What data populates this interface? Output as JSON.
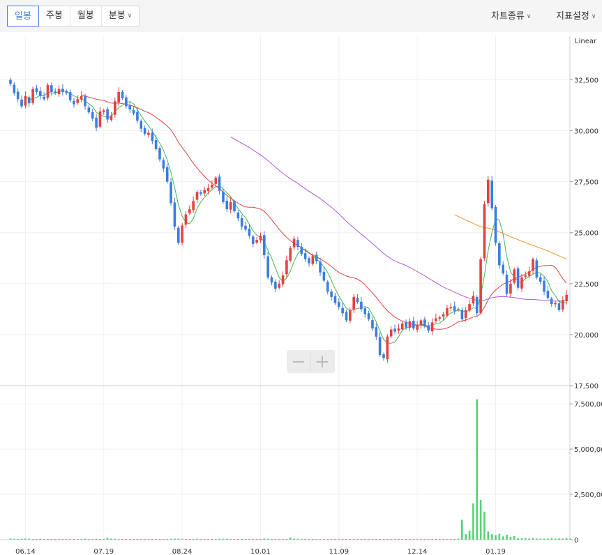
{
  "toolbar": {
    "tabs": [
      {
        "label": "일봉"
      },
      {
        "label": "주봉"
      },
      {
        "label": "월봉"
      },
      {
        "label": "분봉"
      }
    ],
    "chart_type_menu": "차트종류",
    "indicator_menu": "지표설정"
  },
  "zoom": {
    "minus": "−",
    "plus": "+"
  },
  "chart_data": {
    "type": "candlestick",
    "scale_label": "Linear",
    "price_axis": {
      "range": [
        17500,
        34500
      ],
      "ticks": [
        {
          "v": 32500,
          "label": "32,500"
        },
        {
          "v": 30000,
          "label": "30,000"
        },
        {
          "v": 27500,
          "label": "27,500"
        },
        {
          "v": 25000,
          "label": "25,000"
        },
        {
          "v": 22500,
          "label": "22,500"
        },
        {
          "v": 20000,
          "label": "20,000"
        },
        {
          "v": 17500,
          "label": "17,500"
        }
      ]
    },
    "volume_axis": {
      "range": [
        0,
        8200000
      ],
      "ticks": [
        {
          "v": 7500000,
          "label": "7,500,00"
        },
        {
          "v": 5000000,
          "label": "5,000,00"
        },
        {
          "v": 2500000,
          "label": "2,500,00"
        },
        {
          "v": 0,
          "label": "0"
        }
      ]
    },
    "x_labels": [
      {
        "i": 4,
        "label": "06.14"
      },
      {
        "i": 25,
        "label": "07.19"
      },
      {
        "i": 46,
        "label": "08.24"
      },
      {
        "i": 67,
        "label": "10.01"
      },
      {
        "i": 88,
        "label": "11.09"
      },
      {
        "i": 109,
        "label": "12.14"
      },
      {
        "i": 130,
        "label": "01.19"
      }
    ],
    "colors": {
      "up": "#e8403f",
      "down": "#3b7de0",
      "ma5": "#3dbb48",
      "ma20": "#e04040",
      "ma60": "#b15ae0",
      "ma120": "#f0942c",
      "volume": "#58cf77"
    },
    "closes": [
      32300,
      31850,
      31550,
      31200,
      31700,
      31350,
      32050,
      31900,
      31700,
      31550,
      32250,
      31900,
      31850,
      32050,
      31900,
      31850,
      31500,
      31300,
      31550,
      31700,
      31200,
      30900,
      30600,
      30150,
      30950,
      31000,
      30550,
      30750,
      31450,
      31900,
      31600,
      31200,
      31050,
      30850,
      30500,
      30100,
      29850,
      29900,
      29500,
      29100,
      28600,
      28150,
      27500,
      26450,
      25300,
      24500,
      25350,
      25900,
      26150,
      26550,
      27000,
      26900,
      27100,
      27200,
      27350,
      27700,
      27050,
      26500,
      26150,
      26500,
      26050,
      25700,
      25300,
      25150,
      24850,
      24450,
      24650,
      24850,
      23900,
      22800,
      22550,
      22250,
      22500,
      22900,
      23650,
      24250,
      24700,
      24300,
      23950,
      23700,
      23500,
      23850,
      23600,
      23050,
      22650,
      22100,
      21850,
      21550,
      21350,
      21050,
      20700,
      21200,
      21850,
      21600,
      21250,
      21000,
      20750,
      20300,
      19900,
      19000,
      18850,
      19900,
      20250,
      20150,
      20300,
      20550,
      20350,
      20650,
      20300,
      20450,
      20700,
      20400,
      20200,
      20600,
      20800,
      20850,
      21000,
      21300,
      21350,
      21150,
      21250,
      20750,
      21200,
      21500,
      21900,
      21050,
      23700,
      26400,
      27600,
      26200,
      24500,
      23400,
      23000,
      22000,
      22500,
      23200,
      22300,
      22800,
      22900,
      23100,
      23700,
      22800,
      22600,
      22100,
      21800,
      21500,
      21550,
      21200,
      21700,
      21950
    ],
    "volumes": [
      60000,
      50000,
      40000,
      50000,
      60000,
      50000,
      40000,
      40000,
      50000,
      40000,
      40000,
      40000,
      40000,
      40000,
      40000,
      40000,
      40000,
      40000,
      40000,
      40000,
      50000,
      40000,
      40000,
      50000,
      40000,
      40000,
      100000,
      60000,
      50000,
      40000,
      40000,
      40000,
      40000,
      40000,
      40000,
      40000,
      40000,
      40000,
      40000,
      40000,
      40000,
      40000,
      40000,
      50000,
      60000,
      60000,
      50000,
      40000,
      40000,
      40000,
      50000,
      40000,
      40000,
      40000,
      40000,
      40000,
      50000,
      50000,
      50000,
      40000,
      40000,
      40000,
      40000,
      40000,
      40000,
      40000,
      40000,
      40000,
      60000,
      50000,
      40000,
      40000,
      40000,
      40000,
      40000,
      120000,
      60000,
      50000,
      40000,
      40000,
      40000,
      40000,
      40000,
      40000,
      40000,
      40000,
      40000,
      40000,
      40000,
      40000,
      40000,
      40000,
      40000,
      40000,
      40000,
      40000,
      40000,
      40000,
      40000,
      40000,
      40000,
      40000,
      40000,
      40000,
      40000,
      40000,
      40000,
      40000,
      40000,
      40000,
      40000,
      40000,
      40000,
      40000,
      40000,
      40000,
      40000,
      40000,
      40000,
      40000,
      60000,
      1100000,
      300000,
      500000,
      2000000,
      7750000,
      2200000,
      1550000,
      450000,
      300000,
      250000,
      320000,
      180000,
      270000,
      150000,
      200000,
      80000,
      80000,
      100000,
      60000,
      90000,
      60000,
      60000,
      60000,
      60000,
      80000,
      60000,
      70000,
      60000,
      80000,
      60000
    ]
  }
}
